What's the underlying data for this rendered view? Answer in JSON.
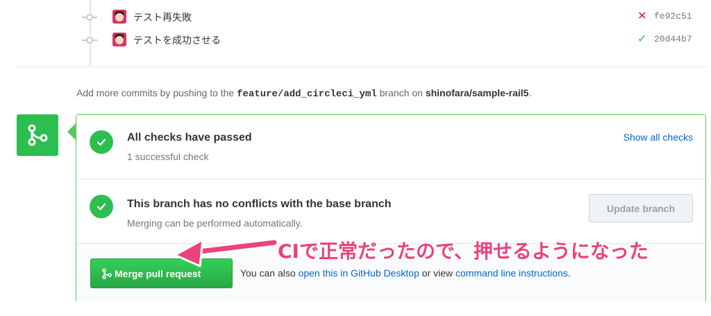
{
  "commits": [
    {
      "message": "テスト再失敗",
      "status": "fail",
      "status_glyph": "✕",
      "sha": "fe92c51"
    },
    {
      "message": "テストを成功させる",
      "status": "success",
      "status_glyph": "✓",
      "sha": "20d44b7"
    }
  ],
  "push_note": {
    "prefix": "Add more commits by pushing to the ",
    "branch": "feature/add_circleci_yml",
    "middle": " branch on ",
    "repo": "shinofara/sample-rail5",
    "suffix": "."
  },
  "checks": {
    "title": "All checks have passed",
    "subtitle": "1 successful check",
    "show_all_label": "Show all checks"
  },
  "conflicts": {
    "title": "This branch has no conflicts with the base branch",
    "subtitle": "Merging can be performed automatically.",
    "update_button_label": "Update branch"
  },
  "merge": {
    "button_label": "Merge pull request",
    "alt_prefix": "You can also ",
    "desktop_link": "open this in GitHub Desktop",
    "alt_middle": " or view ",
    "cli_link": "command line instructions",
    "alt_suffix": "."
  },
  "annotation": {
    "text": "CIで正常だったので、押せるようになった"
  },
  "colors": {
    "success_green": "#2cbe4e",
    "fail_red": "#cb2431",
    "link_blue": "#0366d6",
    "annotation_pink": "#e9437a"
  },
  "icons": {
    "merge_badge": "git-merge-icon",
    "check": "check-icon",
    "commit": "git-commit-icon"
  }
}
